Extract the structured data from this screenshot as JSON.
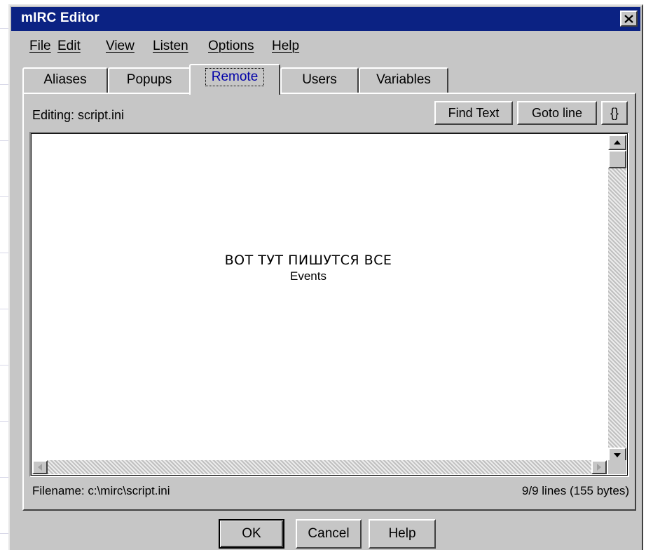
{
  "window": {
    "title": "mIRC Editor",
    "close_glyph": "✕"
  },
  "menu": [
    {
      "label": "File"
    },
    {
      "label": "Edit"
    },
    {
      "label": "View"
    },
    {
      "label": "Listen"
    },
    {
      "label": "Options"
    },
    {
      "label": "Help"
    }
  ],
  "tabs": [
    {
      "label": "Aliases"
    },
    {
      "label": "Popups"
    },
    {
      "label": "Remote",
      "active": true
    },
    {
      "label": "Users"
    },
    {
      "label": "Variables"
    }
  ],
  "toolbar": {
    "editing_label": "Editing: script.ini",
    "find_text": "Find Text",
    "goto_line": "Goto line",
    "braces": "{}"
  },
  "editor": {
    "line1": "ВОТ ТУТ ПИШУТСЯ ВСЕ",
    "line2": "Events"
  },
  "status": {
    "filename": "Filename: c:\\mirc\\script.ini",
    "line_count": "9/9 lines (155 bytes)"
  },
  "buttons": {
    "ok": "OK",
    "cancel": "Cancel",
    "help": "Help"
  },
  "icons": {
    "close": "close-icon",
    "scroll_up": "arrow-up-icon",
    "scroll_down": "arrow-down-icon",
    "scroll_left": "arrow-left-icon",
    "scroll_right": "arrow-right-icon"
  },
  "colors": {
    "titlebar": "#0b2283",
    "face": "#c6c6c6"
  }
}
